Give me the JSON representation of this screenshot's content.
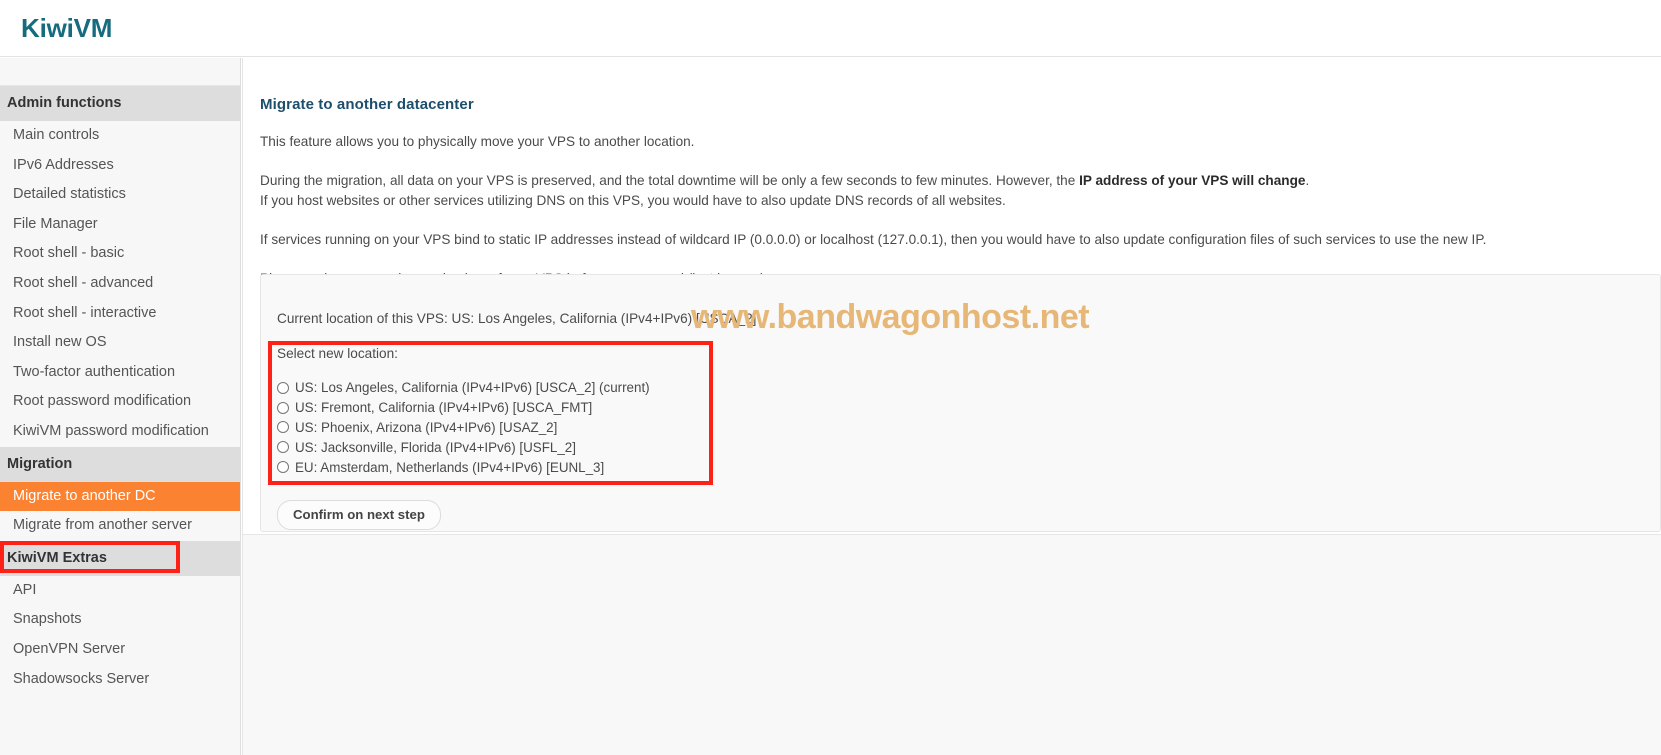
{
  "brand": {
    "name": "KiwiVM"
  },
  "sidebar": {
    "sections": [
      {
        "heading": "Admin functions",
        "items": [
          {
            "label": "Main controls",
            "active": false
          },
          {
            "label": "IPv6 Addresses",
            "active": false
          },
          {
            "label": "Detailed statistics",
            "active": false
          },
          {
            "label": "File Manager",
            "active": false
          },
          {
            "label": "Root shell - basic",
            "active": false
          },
          {
            "label": "Root shell - advanced",
            "active": false
          },
          {
            "label": "Root shell - interactive",
            "active": false
          },
          {
            "label": "Install new OS",
            "active": false
          },
          {
            "label": "Two-factor authentication",
            "active": false
          },
          {
            "label": "Root password modification",
            "active": false
          },
          {
            "label": "KiwiVM password modification",
            "active": false
          }
        ]
      },
      {
        "heading": "Migration",
        "items": [
          {
            "label": "Migrate to another DC",
            "active": true
          },
          {
            "label": "Migrate from another server",
            "active": false
          }
        ]
      },
      {
        "heading": "KiwiVM Extras",
        "items": [
          {
            "label": "API",
            "active": false
          },
          {
            "label": "Snapshots",
            "active": false
          },
          {
            "label": "OpenVPN Server",
            "active": false
          },
          {
            "label": "Shadowsocks Server",
            "active": false
          }
        ]
      }
    ]
  },
  "main": {
    "title": "Migrate to another datacenter",
    "paragraphs": {
      "p1": "This feature allows you to physically move your VPS to another location.",
      "p2_a": "During the migration, all data on your VPS is preserved, and the total downtime will be only a few seconds to few minutes. However, the ",
      "p2_bold": "IP address of your VPS will change",
      "p2_b": ".",
      "p2_line2": "If you host websites or other services utilizing DNS on this VPS, you would have to also update DNS records of all websites.",
      "p3": "If services running on your VPS bind to static IP addresses instead of wildcard IP (0.0.0.0) or localhost (127.0.0.1), then you would have to also update configuration files of such services to use the new IP.",
      "p4": "Please make sure you have a backup of your VPS before you proceed (just in case)."
    },
    "panel": {
      "current_location": "Current location of this VPS: US: Los Angeles, California (IPv4+IPv6) [USCA_2]",
      "select_label": "Select new location:",
      "locations": [
        {
          "label": "US: Los Angeles, California (IPv4+IPv6) [USCA_2] (current)",
          "selected": false
        },
        {
          "label": "US: Fremont, California (IPv4+IPv6) [USCA_FMT]",
          "selected": false
        },
        {
          "label": "US: Phoenix, Arizona (IPv4+IPv6) [USAZ_2]",
          "selected": false
        },
        {
          "label": "US: Jacksonville, Florida (IPv4+IPv6) [USFL_2]",
          "selected": false
        },
        {
          "label": "EU: Amsterdam, Netherlands (IPv4+IPv6) [EUNL_3]",
          "selected": false
        }
      ],
      "confirm_button": "Confirm on next step"
    },
    "watermark": "www.bandwagonhost.net"
  },
  "colors": {
    "brand": "#176b7f",
    "active_item": "#fa8231",
    "annotation": "#fd2118",
    "watermark": "#e6b776",
    "heading": "#1d4f6c"
  }
}
